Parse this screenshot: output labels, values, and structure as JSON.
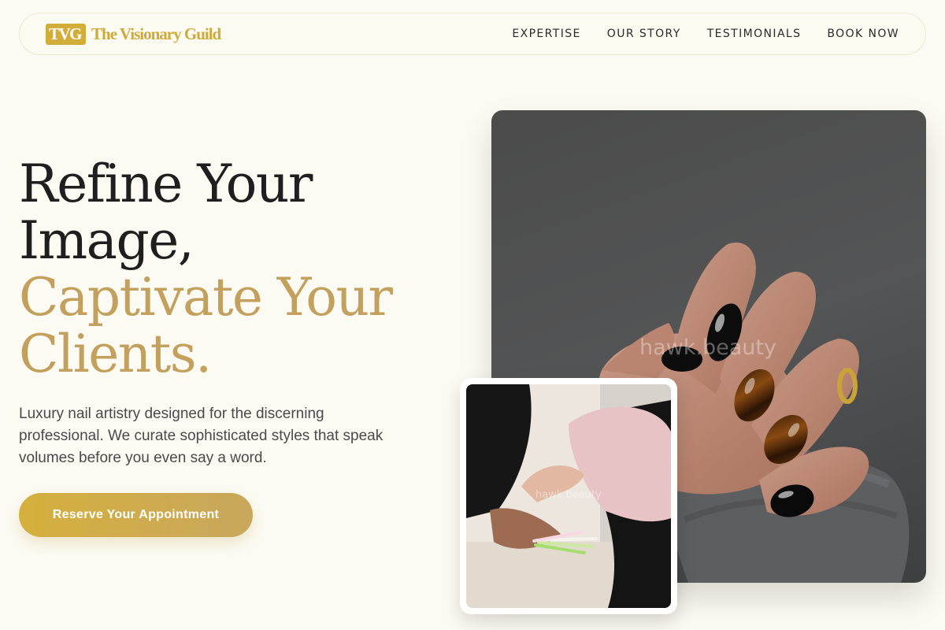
{
  "brand": {
    "logo_text": "TVG",
    "name": "The Visionary Guild"
  },
  "nav": {
    "links": [
      "EXPERTISE",
      "OUR STORY",
      "TESTIMONIALS",
      "BOOK NOW"
    ]
  },
  "hero": {
    "headline_lines": [
      "Refine Your",
      "Image,"
    ],
    "headline_accent_lines": [
      "Captivate Your",
      "Clients."
    ],
    "description": "Luxury nail artistry designed for the discerning professional. We curate sophisticated styles that speak volumes before you even say a word.",
    "cta_label": "Reserve Your Appointment"
  },
  "images": {
    "main_watermark": "hawk.beauty",
    "inset_watermark": "hawk.beauty"
  },
  "colors": {
    "background": "#fcfbf3",
    "accent_gold": "#d3ad3a",
    "headline_accent": "#c4a05e",
    "text_dark": "#1f1f1f"
  }
}
